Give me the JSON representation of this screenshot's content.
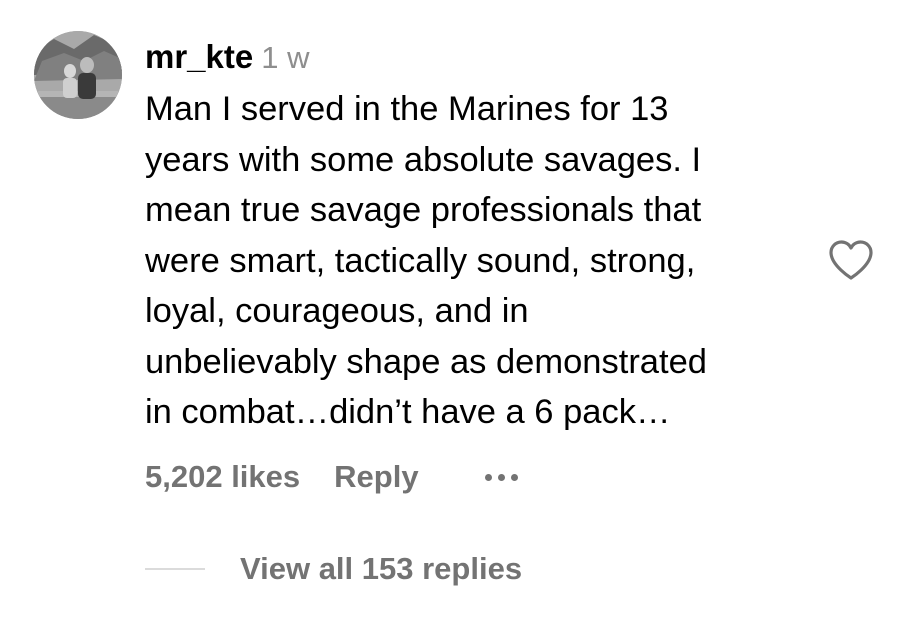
{
  "comment": {
    "username": "mr_kte",
    "time": "1 w",
    "text_lines": [
      "Man I served in the Marines for 13",
      "years with some absolute savages. I",
      "mean true savage professionals that",
      "were smart, tactically sound, strong,",
      "loyal, courageous, and in",
      "unbelievably shape as demonstrated",
      "in combat…didn’t have a 6 pack…"
    ],
    "likes_label": "5,202 likes",
    "reply_label": "Reply",
    "view_replies_label": "View all 153 replies"
  },
  "icons": {
    "like": "heart-outline-icon",
    "more": "more-horizontal-icon"
  },
  "colors": {
    "text": "#000000",
    "secondary_text": "#737373",
    "timestamp": "#8e8e8e",
    "divider": "#dbdbdb",
    "heart_stroke": "#737373"
  }
}
